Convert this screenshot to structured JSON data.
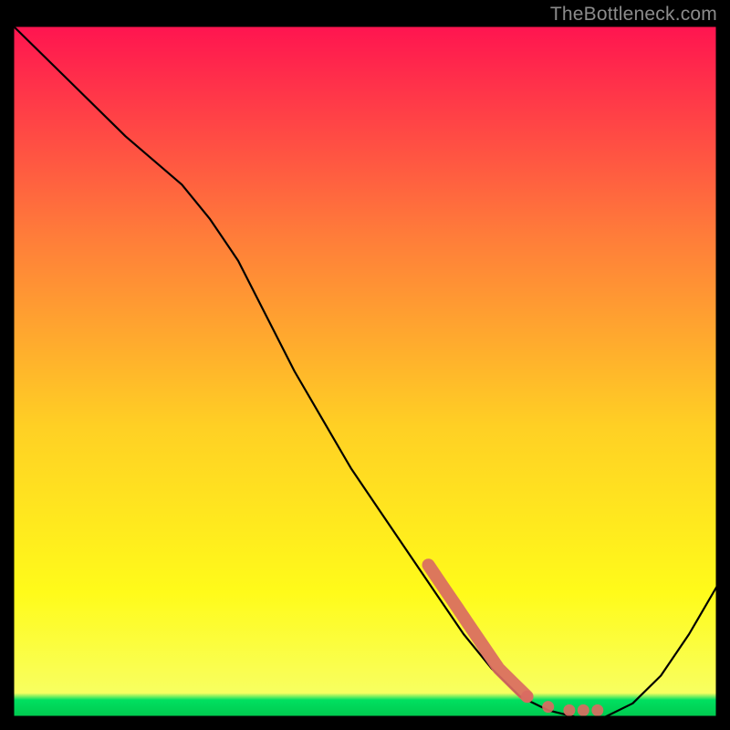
{
  "watermark": "TheBottleneck.com",
  "chart_data": {
    "type": "line",
    "title": "",
    "xlabel": "",
    "ylabel": "",
    "xlim": [
      0,
      100
    ],
    "ylim": [
      0,
      100
    ],
    "grid": false,
    "legend": false,
    "background_gradient": {
      "top": "#ff1450",
      "mid_upper": "#ff7b3a",
      "mid": "#ffd024",
      "mid_lower": "#fffb1a",
      "bottom": "#00e060"
    },
    "series": [
      {
        "name": "bottleneck-curve",
        "color": "#000000",
        "x": [
          0,
          8,
          16,
          24,
          28,
          32,
          36,
          40,
          44,
          48,
          52,
          56,
          60,
          64,
          68,
          72,
          76,
          80,
          84,
          88,
          92,
          96,
          100
        ],
        "y": [
          100,
          92,
          84,
          77,
          72,
          66,
          58,
          50,
          43,
          36,
          30,
          24,
          18,
          12,
          7,
          3,
          1,
          0,
          0,
          2,
          6,
          12,
          19
        ]
      }
    ],
    "highlight_segment": {
      "name": "highlight-dots",
      "color": "#d96b62",
      "x": [
        59,
        61,
        63,
        65,
        67,
        69,
        71,
        73,
        76,
        79,
        81,
        83
      ],
      "y": [
        22,
        19,
        16,
        13,
        10,
        7,
        5,
        3,
        1.5,
        1,
        1,
        1
      ]
    }
  }
}
